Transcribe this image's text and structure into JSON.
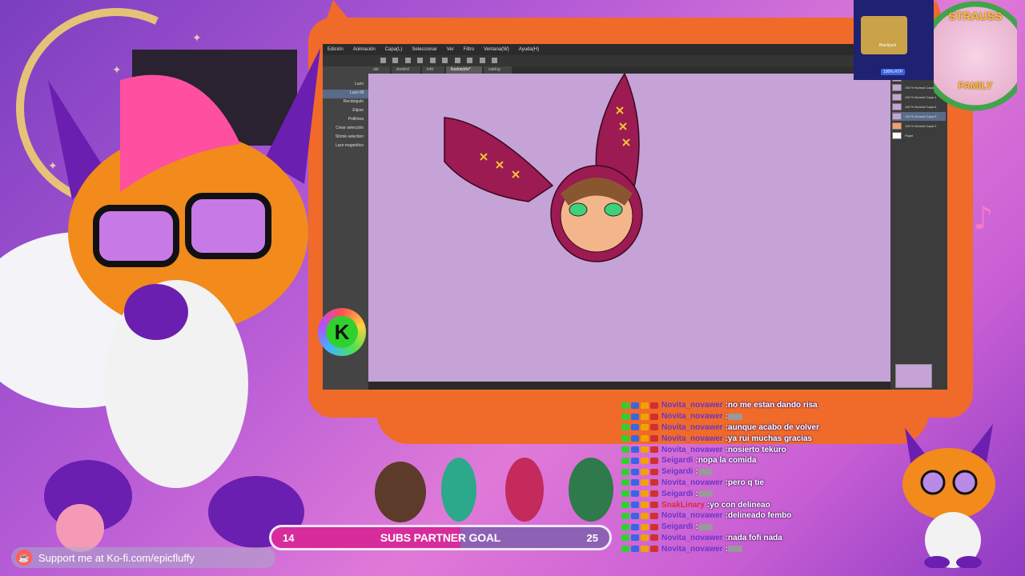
{
  "app": {
    "menu": [
      "Edición",
      "Animación",
      "Capa(L)",
      "Seleccionar",
      "Ver",
      "Filtro",
      "Ventana(W)",
      "Ayuda(H)"
    ],
    "tabs": [
      {
        "label": "akt",
        "active": false
      },
      {
        "label": "skebird",
        "active": false
      },
      {
        "label": "b4tt",
        "active": false
      },
      {
        "label": "llustración*",
        "active": true
      },
      {
        "label": "catdog",
        "active": false
      }
    ],
    "tool_panel": [
      "Lazo",
      "Lazo fill",
      "Rectángulo",
      "Elipse",
      "Polilínea",
      "Crear selección",
      "Shrink selection",
      "Lazo magnético"
    ],
    "layers": [
      {
        "label": "100 % Normal Capa 1",
        "selected": false
      },
      {
        "label": "100 % Normal Capa 3",
        "selected": false
      },
      {
        "label": "100 % Normal Capa 4",
        "selected": false
      },
      {
        "label": "100 % Normal Capa 6",
        "selected": false
      },
      {
        "label": "100 % Normal Capa 5",
        "selected": true
      },
      {
        "label": "100 % Normal Capa 2",
        "selected": false
      },
      {
        "label": "Papel",
        "selected": false
      }
    ]
  },
  "chat": [
    {
      "name": "Novita_novawer",
      "msg": "no me estan dando risa",
      "emote": false,
      "color": "#6a35c9"
    },
    {
      "name": "Novita_novawer",
      "msg": "",
      "emote": true,
      "color": "#6a35c9"
    },
    {
      "name": "Novita_novawer",
      "msg": "aunque acabo de volver",
      "emote": false,
      "color": "#6a35c9"
    },
    {
      "name": "Novita_novawer",
      "msg": "ya rui muchas gracias",
      "emote": false,
      "color": "#6a35c9"
    },
    {
      "name": "Novita_novawer",
      "msg": "nosierto tekuro",
      "emote": false,
      "color": "#6a35c9"
    },
    {
      "name": "Seigardi",
      "msg": "nopa la comida",
      "emote": false,
      "color": "#6a35c9"
    },
    {
      "name": "Seigardi",
      "msg": "",
      "emote": true,
      "color": "#6a35c9"
    },
    {
      "name": "Novita_novawer",
      "msg": "pero q tie",
      "emote": false,
      "color": "#6a35c9"
    },
    {
      "name": "Seigardi",
      "msg": "",
      "emote": true,
      "color": "#6a35c9"
    },
    {
      "name": "SnakLinary",
      "msg": "yo con delineao",
      "emote": false,
      "color": "#e0283b"
    },
    {
      "name": "Novita_novawer",
      "msg": "delineado fembo",
      "emote": false,
      "color": "#6a35c9"
    },
    {
      "name": "Seigardi",
      "msg": "",
      "emote": true,
      "color": "#6a35c9"
    },
    {
      "name": "Novita_novawer",
      "msg": "nada fofi nada",
      "emote": false,
      "color": "#6a35c9"
    },
    {
      "name": "Novita_novawer",
      "msg": "",
      "emote": true,
      "color": "#6a35c9"
    }
  ],
  "goal": {
    "current": "14",
    "label": "SUBS PARTNER GOAL",
    "target": "25",
    "progress": 0.56
  },
  "kofi": {
    "text": "Support me at Ko-fi.com/epicfluffy"
  },
  "ad": {
    "title": "Blackjack",
    "button": "100% RTP"
  },
  "emblem": {
    "top": "STRAUSS",
    "bottom": "FAMILY"
  },
  "badge": {
    "letter": "K"
  },
  "colors": {
    "accent": "#f06a2a",
    "goal_fill": "#d72c9b",
    "canvas": "#c5a3d6",
    "chat_name": "#6a35c9"
  }
}
